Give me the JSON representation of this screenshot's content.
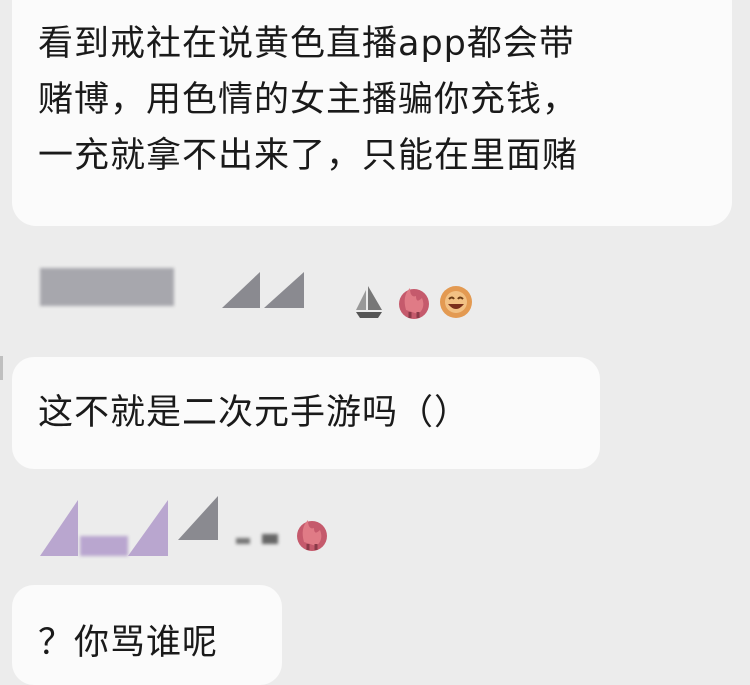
{
  "messages": [
    {
      "lines": [
        "看到戒社在说黄色直播app都会带",
        "赌博，用色情的女主播骗你充钱，",
        "一充就拿不出来了，只能在里面赌"
      ]
    },
    {
      "lines": [
        "这不就是二次元手游吗（）"
      ]
    },
    {
      "lines": [
        "？你骂谁呢"
      ]
    }
  ],
  "colors": {
    "background": "#ececec",
    "bubble": "#fbfbfb",
    "text": "#1a1a1a",
    "redacted_gray": "#a7a7ad",
    "redacted_purple": "#b9a6cf"
  },
  "icons": [
    "sailboat-icon",
    "flame-icon",
    "laughing-face-icon",
    "flame-icon"
  ]
}
